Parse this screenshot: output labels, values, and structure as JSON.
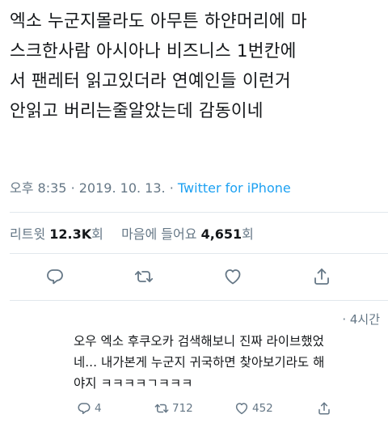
{
  "tweet": {
    "lines": [
      "엑소 누군지몰라도 아무튼 하얀머리에 마",
      "스크한사람 아시아나 비즈니스 1번칸에",
      "서 팬레터 읽고있더라 연예인들 이런거",
      "안읽고 버리는줄알았는데 감동이네"
    ],
    "time": "오후 8:35",
    "separator": "·",
    "date": "2019. 10. 13.",
    "source": "Twitter for iPhone",
    "retweet_label": "리트윗",
    "retweet_count": "12.3K",
    "retweet_suffix": "회",
    "like_label": "마음에 들어요",
    "like_count": "4,651",
    "like_suffix": "회"
  },
  "icons": {
    "reply": "reply-icon",
    "retweet": "retweet-icon",
    "like": "heart-icon",
    "share": "share-icon"
  },
  "reply": {
    "time": "· 4시간",
    "lines": [
      "오우 엑소 후쿠오카 검색해보니 진짜 라이브했었",
      "네... 내가본게 누군지 귀국하면 찾아보기라도 해",
      "야지 ㅋㅋㅋㅋㄱㅋㅋㅋ"
    ],
    "reply_count": "4",
    "retweet_count": "712",
    "like_count": "452"
  },
  "colors": {
    "text": "#14171a",
    "secondary": "#657786",
    "link": "#1da1f2",
    "divider": "#e1e8ed"
  }
}
